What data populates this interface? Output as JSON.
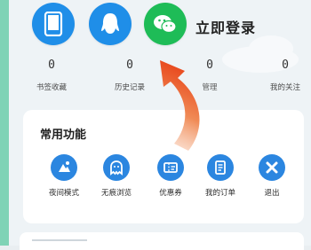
{
  "login": {
    "title": "立即登录",
    "icons": [
      "phone-icon",
      "qq-icon",
      "wechat-icon"
    ]
  },
  "stats": [
    {
      "value": "0",
      "label": "书签收藏"
    },
    {
      "value": "0",
      "label": "历史记录"
    },
    {
      "value": "0",
      "label": "管理"
    },
    {
      "value": "0",
      "label": "我的关注"
    }
  ],
  "functions": {
    "title": "常用功能",
    "items": [
      {
        "label": "夜间模式",
        "icon": "night-mode-icon"
      },
      {
        "label": "无痕浏览",
        "icon": "ghost-icon"
      },
      {
        "label": "优惠券",
        "icon": "coupon-icon"
      },
      {
        "label": "我的订单",
        "icon": "order-icon"
      },
      {
        "label": "退出",
        "icon": "close-icon"
      }
    ]
  },
  "colors": {
    "blue": "#1f8ee8",
    "green": "#1ebc57",
    "arrow_start": "#f7c2a4",
    "arrow_end": "#e8471c"
  }
}
